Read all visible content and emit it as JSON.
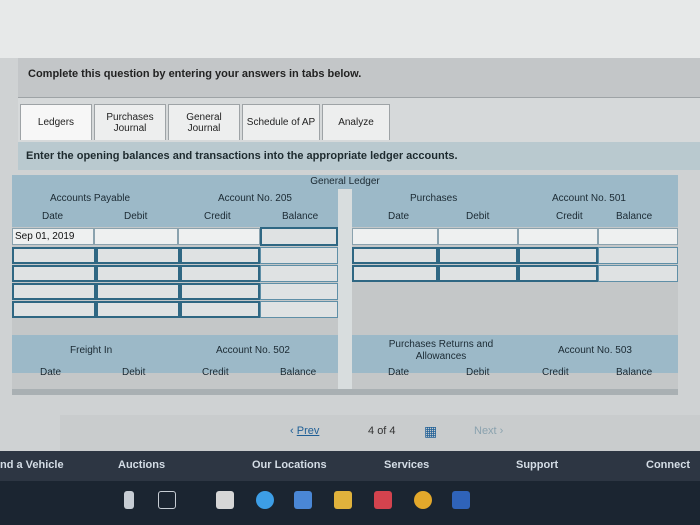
{
  "banner": {
    "text": "Complete this question by entering your answers in tabs below."
  },
  "tabs": [
    {
      "label": "Ledgers"
    },
    {
      "label": "Purchases Journal"
    },
    {
      "label": "General Journal"
    },
    {
      "label": "Schedule of AP"
    },
    {
      "label": "Analyze"
    }
  ],
  "instruction": "Enter the opening balances and transactions into the appropriate ledger accounts.",
  "general_ledger": {
    "title": "General Ledger",
    "accounts_payable": {
      "name": "Accounts Payable",
      "account_no": "Account No. 205",
      "columns": [
        "Date",
        "Debit",
        "Credit",
        "Balance"
      ],
      "first_row_date": "Sep 01, 2019"
    },
    "purchases": {
      "name": "Purchases",
      "account_no": "Account No. 501",
      "columns": [
        "Date",
        "Debit",
        "Credit",
        "Balance"
      ]
    },
    "freight_in": {
      "name": "Freight In",
      "account_no": "Account No. 502",
      "columns": [
        "Date",
        "Debit",
        "Credit",
        "Balance"
      ]
    },
    "purchases_returns": {
      "name": "Purchases Returns and Allowances",
      "account_no": "Account No. 503",
      "columns": [
        "Date",
        "Debit",
        "Credit",
        "Balance"
      ]
    }
  },
  "pagination": {
    "prev": "Prev",
    "page": "4",
    "of": "of 4",
    "next": "Next"
  },
  "footer": {
    "items": [
      "nd a Vehicle",
      "Auctions",
      "Our Locations",
      "Services",
      "Support",
      "Connect"
    ]
  },
  "taskbar": {
    "icons": [
      "cortana-icon",
      "task-view-icon",
      "store-icon",
      "edge-icon",
      "mail-icon",
      "folder-icon",
      "app-icon",
      "chrome-icon",
      "word-icon"
    ]
  }
}
